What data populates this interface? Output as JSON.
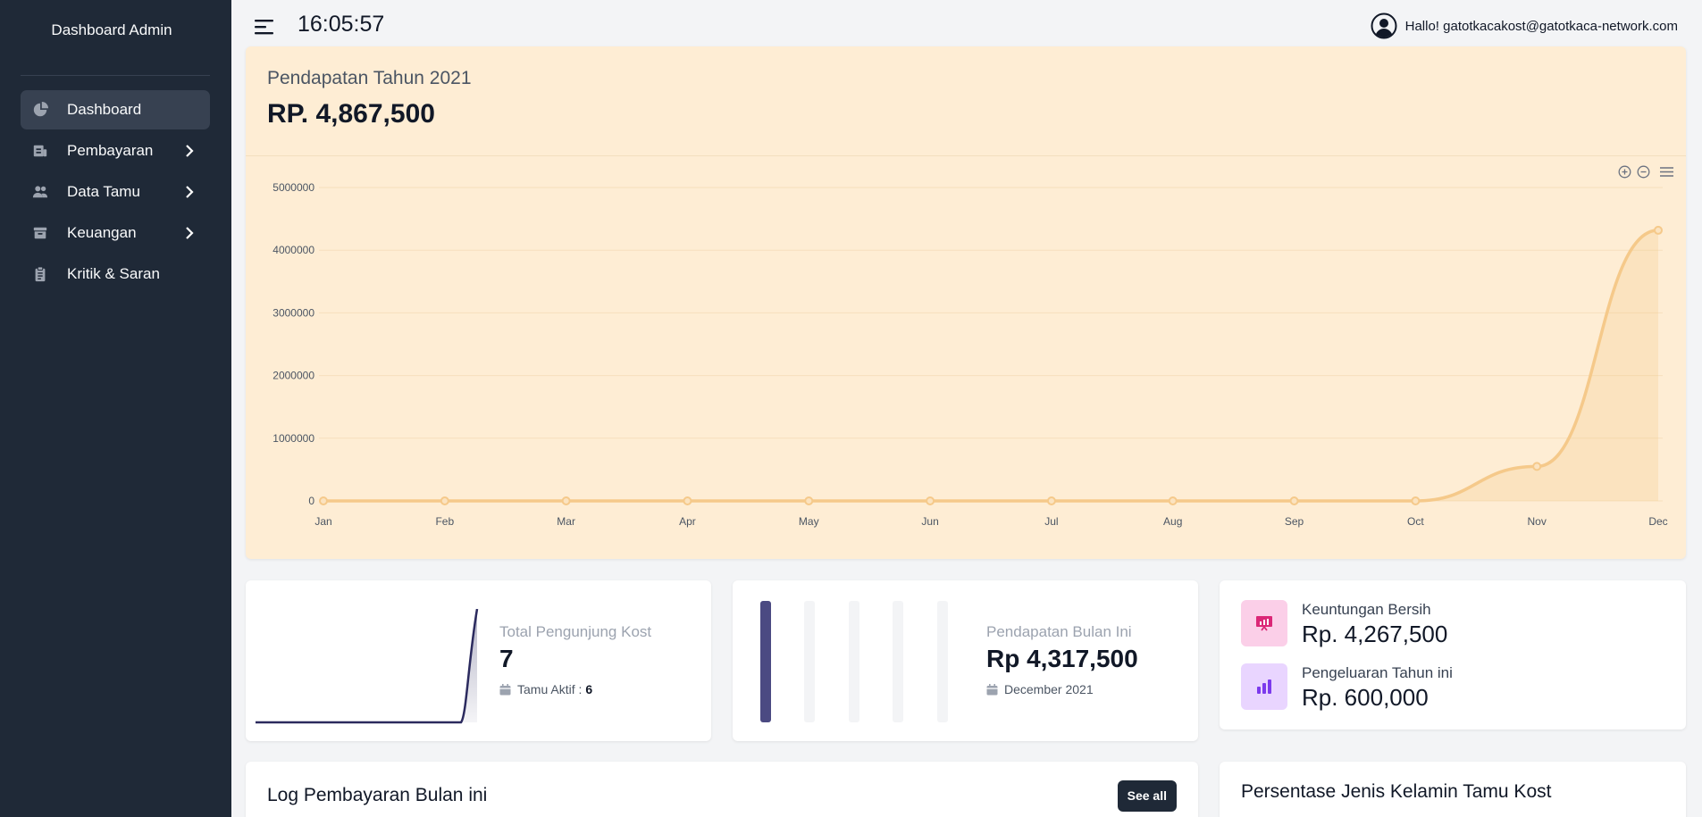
{
  "sidebar": {
    "brand": "Dashboard Admin",
    "items": [
      {
        "label": "Dashboard",
        "icon": "pie-chart-icon",
        "active": true,
        "has_submenu": false
      },
      {
        "label": "Pembayaran",
        "icon": "receipt-icon",
        "active": false,
        "has_submenu": true
      },
      {
        "label": "Data Tamu",
        "icon": "users-icon",
        "active": false,
        "has_submenu": true
      },
      {
        "label": "Keuangan",
        "icon": "archive-icon",
        "active": false,
        "has_submenu": true
      },
      {
        "label": "Kritik & Saran",
        "icon": "clipboard-icon",
        "active": false,
        "has_submenu": false
      }
    ]
  },
  "topbar": {
    "clock": "16:05:57",
    "greeting": "Hallo! gatotkacakost@gatotkaca-network.com"
  },
  "revenue": {
    "title": "Pendapatan Tahun 2021",
    "total": "RP. 4,867,500"
  },
  "chart_data": {
    "type": "area",
    "x": [
      "Jan",
      "Feb",
      "Mar",
      "Apr",
      "May",
      "Jun",
      "Jul",
      "Aug",
      "Sep",
      "Oct",
      "Nov",
      "Dec"
    ],
    "series": [
      {
        "values": [
          0,
          0,
          0,
          0,
          0,
          0,
          0,
          0,
          0,
          0,
          550000,
          4317500
        ]
      }
    ],
    "y_ticks": [
      "0",
      "1000000",
      "2000000",
      "3000000",
      "4000000",
      "5000000"
    ],
    "ylim": [
      0,
      5000000
    ],
    "grid": true,
    "color": "#f5c98a"
  },
  "stats": {
    "visitors": {
      "label": "Total Pengunjung Kost",
      "value": "7",
      "sub_label": "Tamu Aktif :",
      "sub_value": "6"
    },
    "monthly": {
      "label": "Pendapatan Bulan Ini",
      "value": "Rp 4,317,500",
      "sub_label": "December 2021"
    },
    "profit": {
      "label": "Keuntungan Bersih",
      "value": "Rp. 4,267,500"
    },
    "expense": {
      "label": "Pengeluaran Tahun ini",
      "value": "Rp. 600,000"
    }
  },
  "log": {
    "title": "Log Pembayaran Bulan ini",
    "button": "See all"
  },
  "gender": {
    "title": "Persentase Jenis Kelamin Tamu Kost"
  },
  "colors": {
    "sidebar": "#1f2937",
    "accent_orange": "#f5c98a",
    "navy": "#2b2a5e"
  }
}
